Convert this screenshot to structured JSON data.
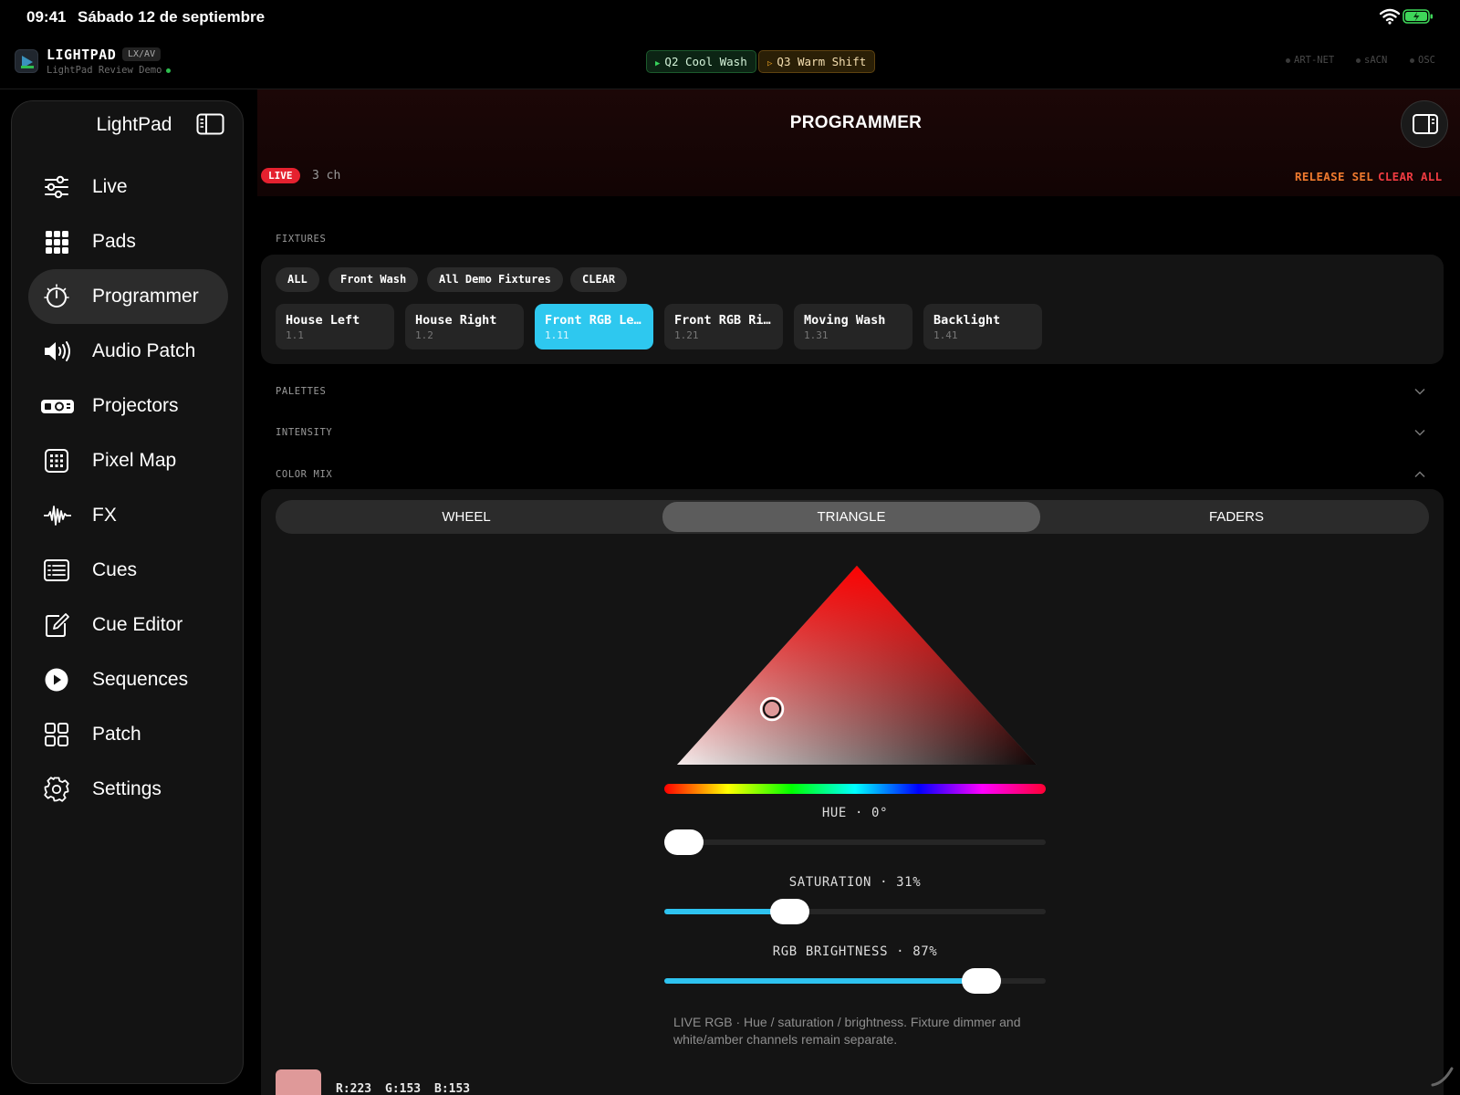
{
  "status": {
    "time": "09:41",
    "date": "Sábado 12 de septiembre"
  },
  "app": {
    "name": "LIGHTPAD",
    "tag": "LX/AV",
    "subtitle": "LightPad Review Demo",
    "cues": [
      {
        "label": "Q2 Cool Wash",
        "state": "playing"
      },
      {
        "label": "Q3 Warm Shift",
        "state": "next"
      }
    ],
    "protocols": [
      "ART-NET",
      "sACN",
      "OSC"
    ]
  },
  "sidebar": {
    "title": "LightPad",
    "items": [
      {
        "label": "Live",
        "icon": "sliders-icon"
      },
      {
        "label": "Pads",
        "icon": "grid-icon"
      },
      {
        "label": "Programmer",
        "icon": "dial-icon",
        "active": true
      },
      {
        "label": "Audio Patch",
        "icon": "speaker-icon"
      },
      {
        "label": "Projectors",
        "icon": "projector-icon"
      },
      {
        "label": "Pixel Map",
        "icon": "pixel-grid-icon"
      },
      {
        "label": "FX",
        "icon": "waveform-icon"
      },
      {
        "label": "Cues",
        "icon": "list-icon"
      },
      {
        "label": "Cue Editor",
        "icon": "edit-icon"
      },
      {
        "label": "Sequences",
        "icon": "play-circle-icon"
      },
      {
        "label": "Patch",
        "icon": "squares-icon"
      },
      {
        "label": "Settings",
        "icon": "gear-icon"
      }
    ]
  },
  "main": {
    "title": "PROGRAMMER",
    "live_label": "LIVE",
    "channel_count": "3 ch",
    "release_sel": "RELEASE SEL",
    "clear_all": "CLEAR ALL",
    "sections": {
      "fixtures": "FIXTURES",
      "palettes": "PALETTES",
      "intensity": "INTENSITY",
      "color_mix": "COLOR MIX"
    },
    "groups": [
      "ALL",
      "Front Wash",
      "All Demo Fixtures",
      "CLEAR"
    ],
    "fixtures": [
      {
        "name": "House Left",
        "addr": "1.1"
      },
      {
        "name": "House Right",
        "addr": "1.2"
      },
      {
        "name": "Front RGB Le…",
        "addr": "1.11",
        "selected": true
      },
      {
        "name": "Front RGB Ri…",
        "addr": "1.21"
      },
      {
        "name": "Moving Wash",
        "addr": "1.31"
      },
      {
        "name": "Backlight",
        "addr": "1.41"
      }
    ],
    "color_mix": {
      "modes": [
        "WHEEL",
        "TRIANGLE",
        "FADERS"
      ],
      "active_mode": "TRIANGLE",
      "hue_label": "HUE · 0°",
      "hue_value": 0,
      "saturation_label": "SATURATION · 31%",
      "saturation_value": 0.31,
      "brightness_label": "RGB BRIGHTNESS · 87%",
      "brightness_value": 0.87,
      "note": "LIVE RGB · Hue / saturation / brightness. Fixture dimmer and white/amber channels remain separate.",
      "swatch_color": "#df9999",
      "r_label": "R:223",
      "g_label": "G:153",
      "b_label": "B:153"
    }
  },
  "colors": {
    "accent_cyan": "#2ec8ef",
    "live_red": "#e5212f",
    "release_orange": "#f07a2e",
    "clear_red": "#ef3b41"
  }
}
